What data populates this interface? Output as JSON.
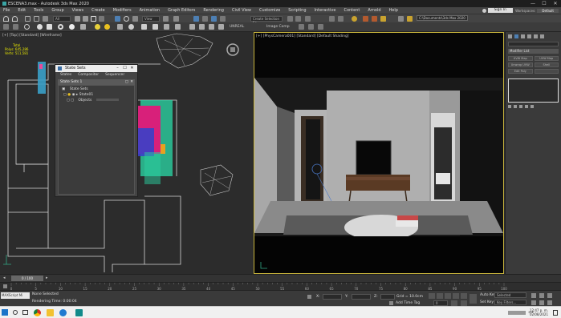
{
  "window": {
    "title": "ESCENA3.max - Autodesk 3ds Max 2020",
    "controls": [
      "—",
      "☐",
      "✕"
    ]
  },
  "menu": [
    "File",
    "Edit",
    "Tools",
    "Group",
    "Views",
    "Create",
    "Modifiers",
    "Animation",
    "Graph Editors",
    "Rendering",
    "Civil View",
    "Customize",
    "Scripting",
    "Interactive",
    "Content",
    "Arnold",
    "Help"
  ],
  "account": {
    "signin_label": "Sign In",
    "workspaces_label": "Workspaces:",
    "workspace_value": "Default"
  },
  "toolbar": {
    "filter_value": "All",
    "view_value": "View",
    "selection_set_value": "Create Selection Se",
    "path_value": "C:\\Documents\\3ds Max 2020",
    "unreal_label": "UNREAL",
    "image_comp_label": "Image Comp"
  },
  "left_viewport": {
    "label": "[+] [Top] [Standard] [Wireframe]",
    "stats": {
      "total_label": "Total",
      "polys_label": "Polys:",
      "polys_value": "645,286",
      "verts_label": "Verts:",
      "verts_value": "511,581"
    }
  },
  "right_viewport": {
    "label": "[+] [PhysCamera001] [Standard] [Default Shading]"
  },
  "state_sets": {
    "title": "State Sets",
    "menu": [
      "States",
      "Compositor",
      "Sequencer"
    ],
    "header": "State Sets 1",
    "rows": [
      {
        "label": "State Sets"
      },
      {
        "label": "State01"
      },
      {
        "label": "Objects"
      }
    ]
  },
  "command_panel": {
    "list_label": "Modifier List",
    "buttons": [
      "UVW Map",
      "UVW Map",
      "Unwrap UVW",
      "Shell",
      "Edit Poly",
      ""
    ]
  },
  "timeline": {
    "frame_label": "0 / 100",
    "ticks": [
      0,
      5,
      10,
      15,
      20,
      25,
      30,
      35,
      40,
      45,
      50,
      55,
      60,
      65,
      70,
      75,
      80,
      85,
      90,
      95,
      100
    ]
  },
  "status": {
    "maxscript_label": "MAXScript Mi",
    "selection_text": "None Selected",
    "render_time_label": "Rendering Time: 0:00:04",
    "x_label": "X:",
    "y_label": "Y:",
    "z_label": "Z:",
    "grid_label": "Grid = 10.0cm",
    "add_time_tag_label": "Add Time Tag",
    "auto_key_label": "Auto Key",
    "set_key_label": "Set Key",
    "selected_value": "Selected",
    "key_filters_label": "Key Filters...",
    "frame_value": "0"
  },
  "taskbar": {
    "time": "12:47 p. m.",
    "date": "02/08/2021",
    "lang": "ESP"
  }
}
